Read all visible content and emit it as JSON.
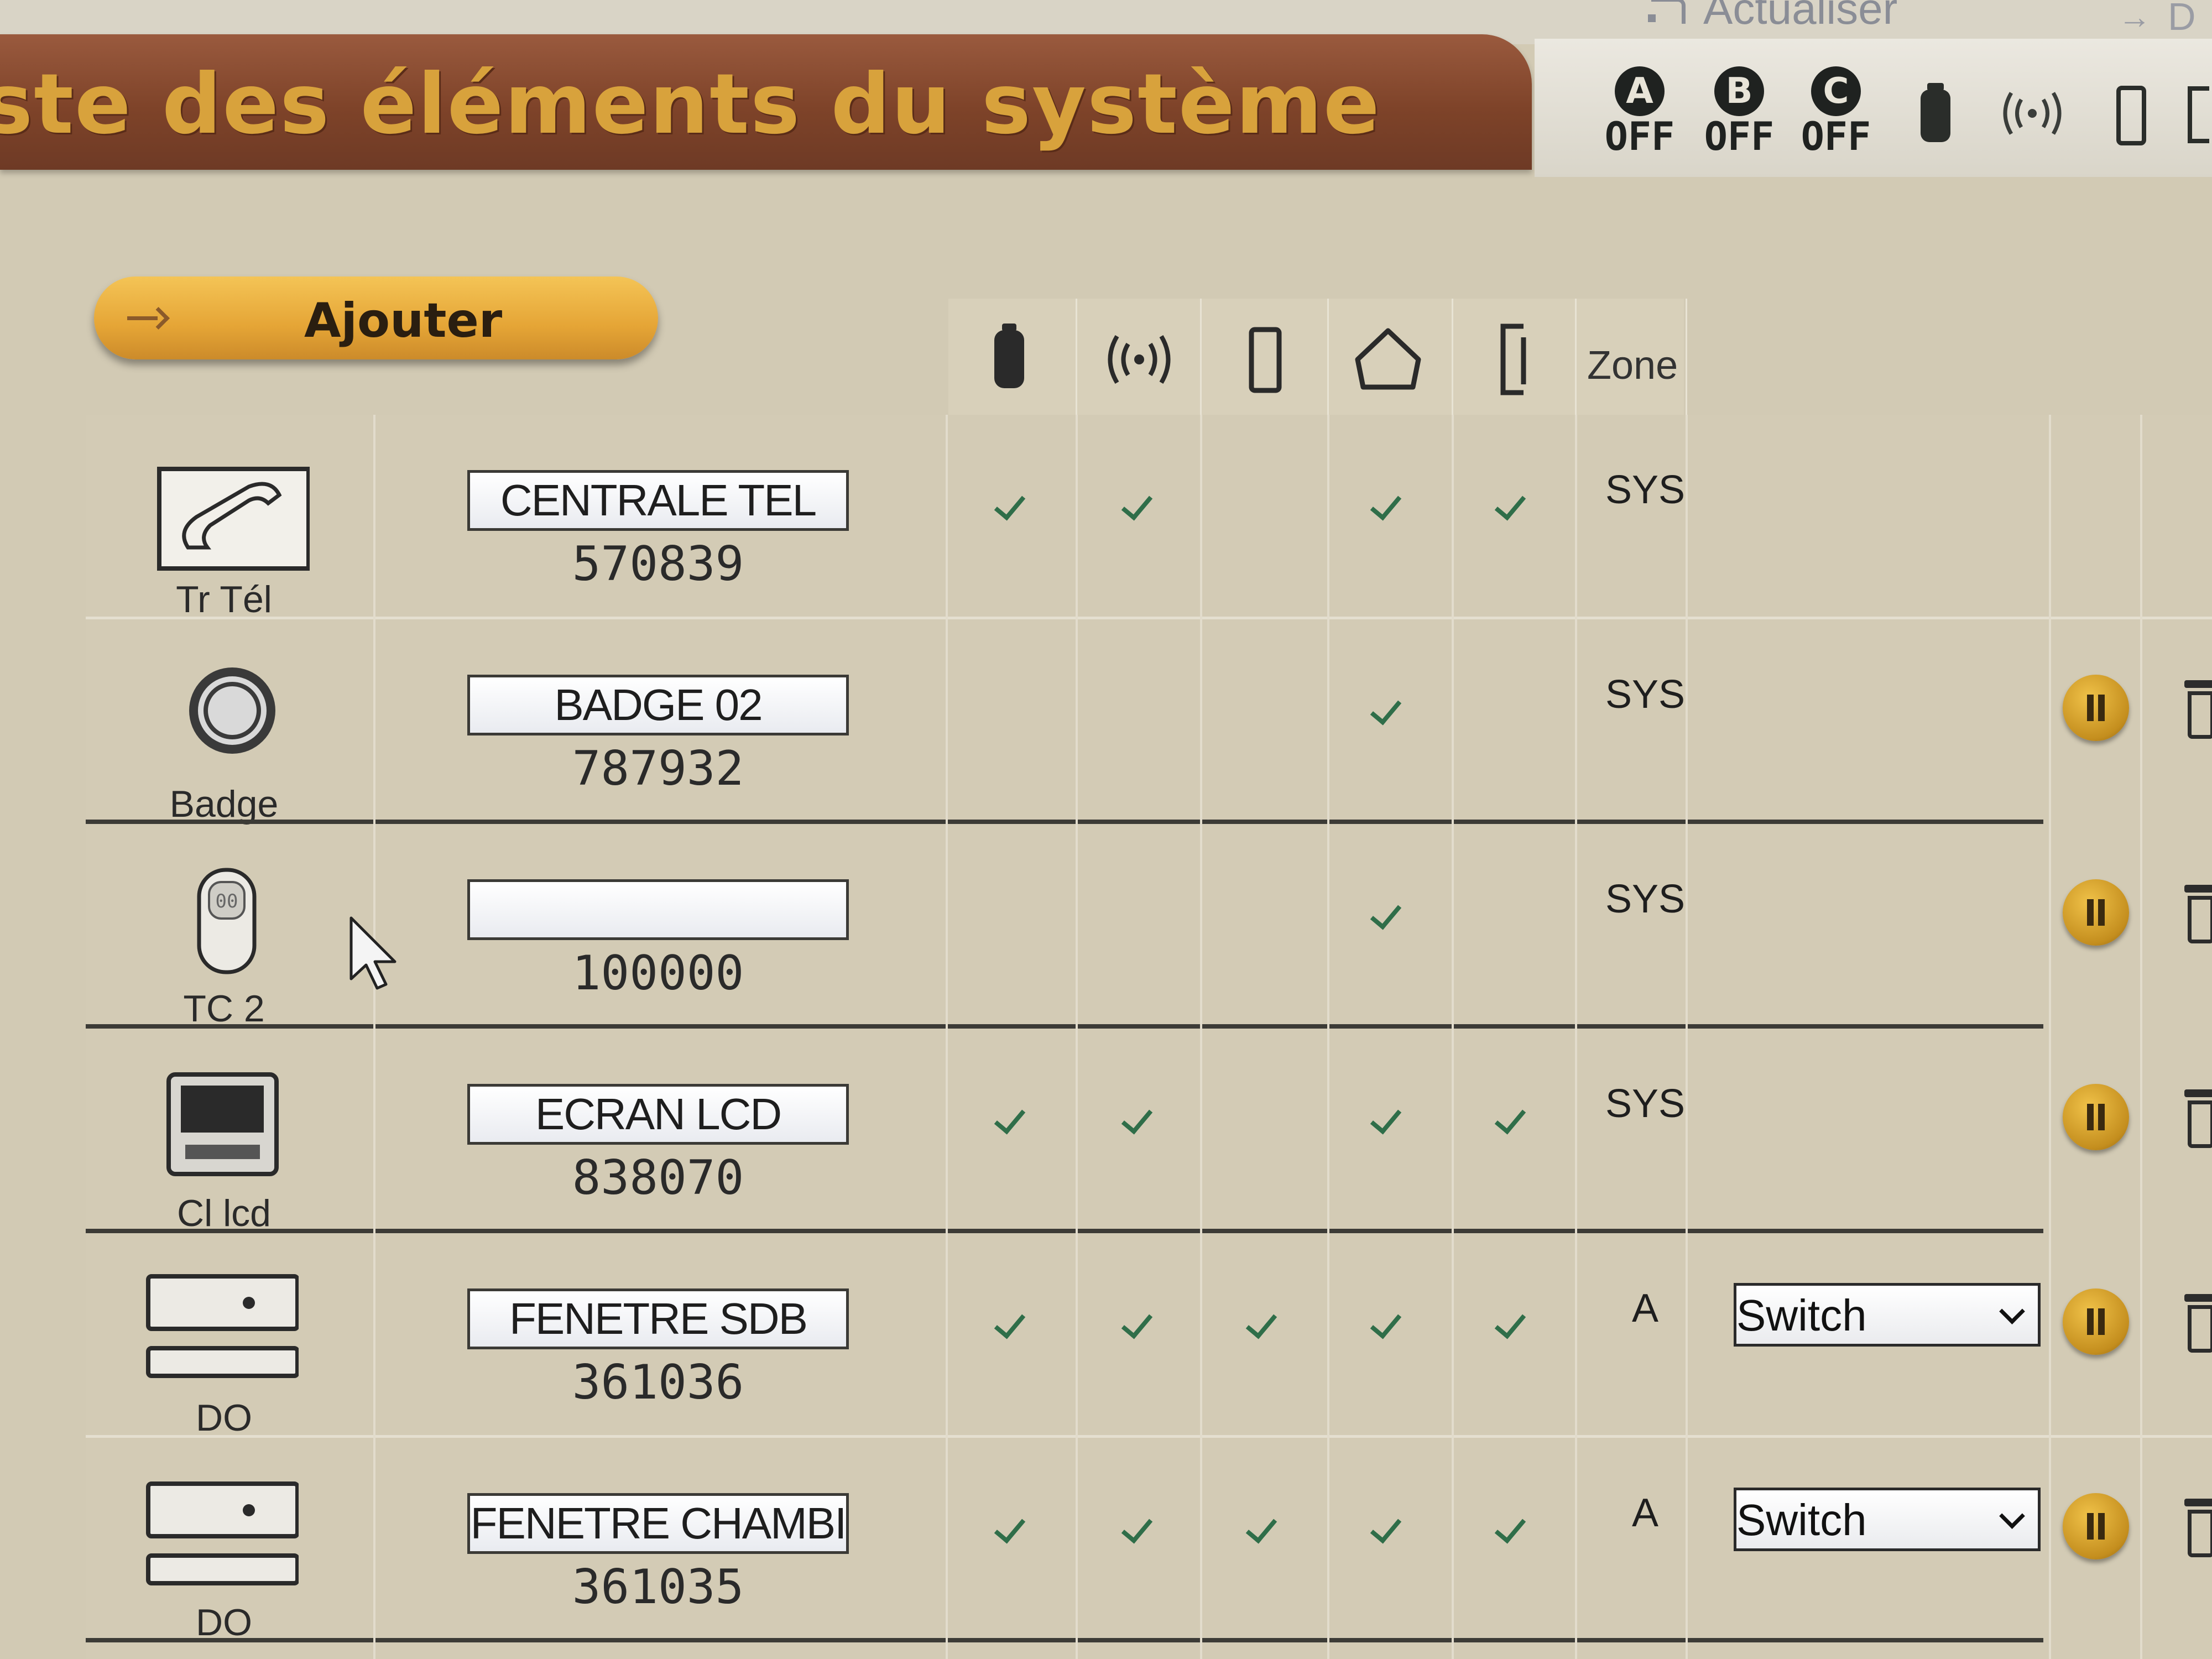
{
  "topbar": {
    "refresh_label": "Actualiser",
    "right_label": "D"
  },
  "header": {
    "title": "ste des éléments du système"
  },
  "modes": [
    {
      "letter": "A",
      "state": "OFF"
    },
    {
      "letter": "B",
      "state": "OFF"
    },
    {
      "letter": "C",
      "state": "OFF"
    }
  ],
  "status_icons": [
    "battery-icon",
    "signal-icon",
    "door-icon",
    "tamper-icon"
  ],
  "add_button": {
    "label": "Ajouter"
  },
  "columns": {
    "icons": [
      "battery-icon",
      "radio-signal-icon",
      "door-icon",
      "home-icon",
      "tamper-icon"
    ],
    "zone_label": "Zone"
  },
  "rows": [
    {
      "device_icon": "telephone-icon",
      "device_type": "Tr Tél",
      "name": "CENTRALE TEL",
      "id": "570839",
      "checks": [
        true,
        true,
        false,
        true,
        true
      ],
      "zone": "SYS",
      "action_buttons": false
    },
    {
      "device_icon": "badge-icon",
      "device_type": "Badge",
      "name": "BADGE 02",
      "id": "787932",
      "checks": [
        false,
        false,
        false,
        true,
        false
      ],
      "zone": "SYS",
      "action_buttons": true
    },
    {
      "device_icon": "remote-control-icon",
      "device_type": "TC 2",
      "name": "",
      "id": "100000",
      "checks": [
        false,
        false,
        false,
        true,
        false
      ],
      "zone": "SYS",
      "action_buttons": true
    },
    {
      "device_icon": "lcd-keypad-icon",
      "device_type": "Cl lcd",
      "name": "ECRAN LCD",
      "id": "838070",
      "checks": [
        true,
        true,
        false,
        true,
        true
      ],
      "zone": "SYS",
      "action_buttons": true
    },
    {
      "device_icon": "door-opening-detector-icon",
      "device_type": "DO",
      "name": "FENETRE SDB",
      "id": "361036",
      "checks": [
        true,
        true,
        true,
        true,
        true
      ],
      "zone": "A",
      "mode_select": "Switch",
      "action_buttons": true
    },
    {
      "device_icon": "door-opening-detector-icon",
      "device_type": "DO",
      "name": "FENETRE CHAMBI",
      "id": "361035",
      "checks": [
        true,
        true,
        true,
        true,
        true
      ],
      "zone": "A",
      "mode_select": "Switch",
      "action_buttons": true
    }
  ],
  "colors": {
    "header_brown": "#7e4329",
    "title_gold": "#d8a23c",
    "check_green": "#2f6e49",
    "button_orange": "#e5a536"
  }
}
